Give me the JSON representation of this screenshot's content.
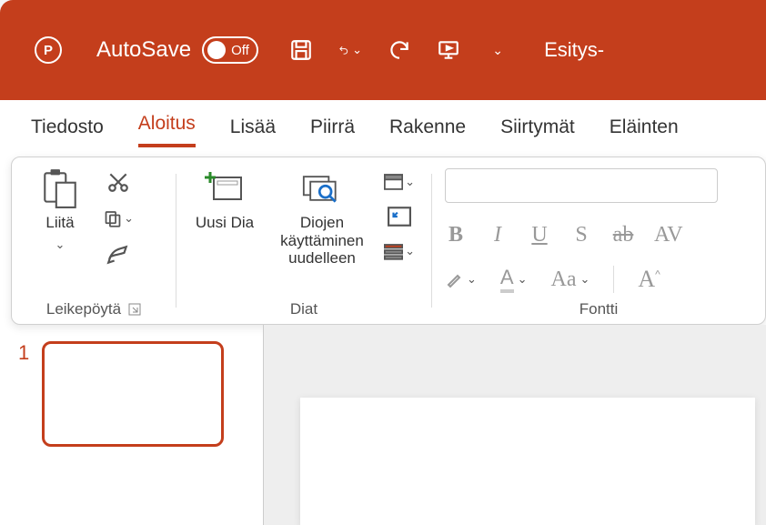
{
  "titlebar": {
    "autosave_label": "AutoSave",
    "autosave_state": "Off",
    "doc_name": "Esitys-"
  },
  "tabs": {
    "file": "Tiedosto",
    "home": "Aloitus",
    "insert": "Lisää",
    "draw": "Piirrä",
    "design": "Rakenne",
    "transitions": "Siirtymät",
    "animations": "Eläinten"
  },
  "ribbon": {
    "clipboard": {
      "paste": "Liitä",
      "group": "Leikepöytä"
    },
    "slides": {
      "new_slide": "Uusi Dia",
      "reuse": "Diojen käyttäminen uudelleen",
      "group": "Diat"
    },
    "font": {
      "group": "Fontti",
      "bold": "B",
      "italic": "I",
      "underline": "U",
      "shadow": "S",
      "strike": "ab",
      "spacing": "AV",
      "case": "Aa",
      "grow": "A^"
    }
  },
  "thumbs": {
    "slide1_num": "1"
  },
  "colors": {
    "brand": "#c43e1c"
  }
}
